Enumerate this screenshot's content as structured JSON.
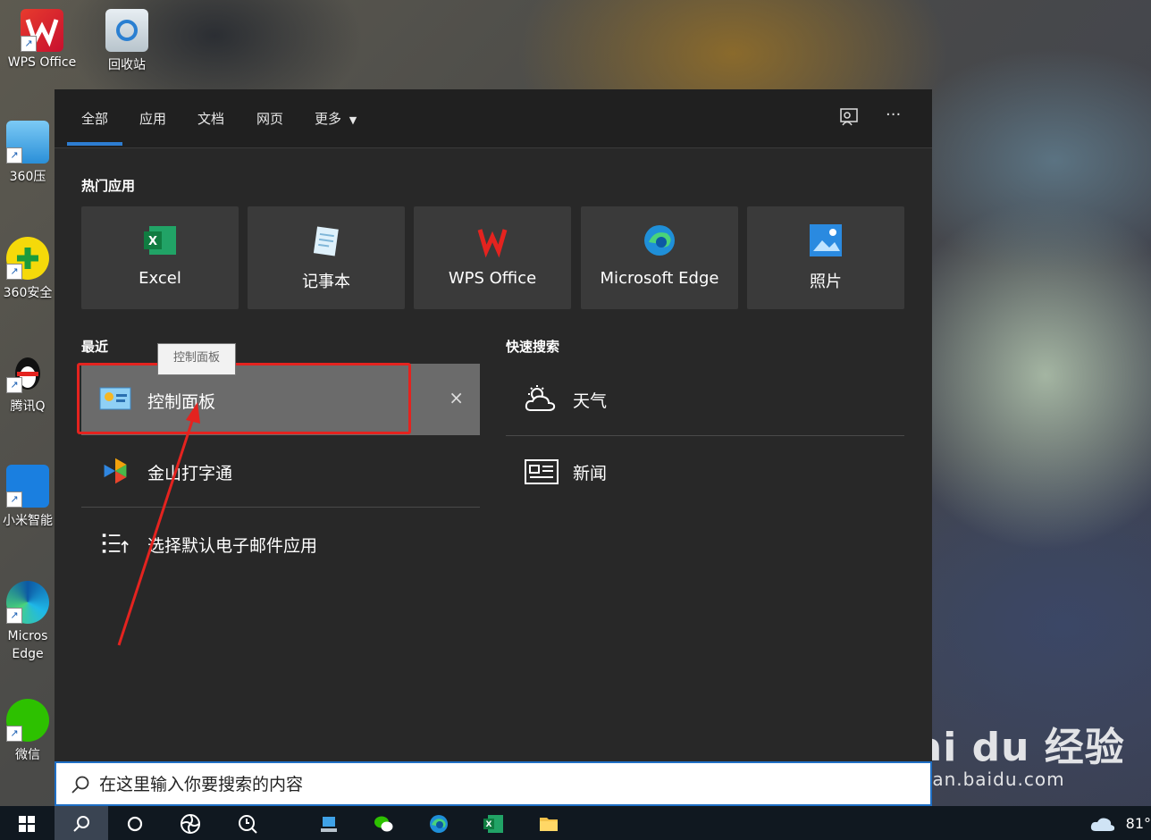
{
  "desktop": {
    "icons": [
      {
        "label": "WPS Office"
      },
      {
        "label": "回收站"
      },
      {
        "label": "360压"
      },
      {
        "label": "360安全"
      },
      {
        "label": "腾讯Q"
      },
      {
        "label": "小米智能"
      },
      {
        "label": "Micros Edge"
      },
      {
        "label": "微信"
      }
    ]
  },
  "search_panel": {
    "tabs": [
      "全部",
      "应用",
      "文档",
      "网页",
      "更多"
    ],
    "active_tab": "全部",
    "hot_apps_title": "热门应用",
    "hot_apps": [
      {
        "label": "Excel",
        "icon": "excel-icon"
      },
      {
        "label": "记事本",
        "icon": "notepad-icon"
      },
      {
        "label": "WPS Office",
        "icon": "wps-icon"
      },
      {
        "label": "Microsoft Edge",
        "icon": "edge-icon"
      },
      {
        "label": "照片",
        "icon": "photos-icon"
      }
    ],
    "recent_title": "最近",
    "recent": [
      {
        "label": "控制面板",
        "icon": "control-panel-icon"
      },
      {
        "label": "金山打字通",
        "icon": "typing-app-icon"
      },
      {
        "label": "选择默认电子邮件应用",
        "icon": "list-settings-icon"
      }
    ],
    "tooltip": "控制面板",
    "quick_search_title": "快速搜索",
    "quick_search": [
      {
        "label": "天气",
        "icon": "weather-icon"
      },
      {
        "label": "新闻",
        "icon": "news-icon"
      }
    ],
    "close_label": "×"
  },
  "searchbar": {
    "placeholder": "在这里输入你要搜索的内容"
  },
  "taskbar": {
    "temperature": "81°"
  },
  "watermark": {
    "main": "Bai du 经验",
    "sub": "jingyan.baidu.com"
  },
  "colors": {
    "accent": "#2d7dd2",
    "highlight": "#e4231f",
    "panel_bg": "#282828"
  }
}
